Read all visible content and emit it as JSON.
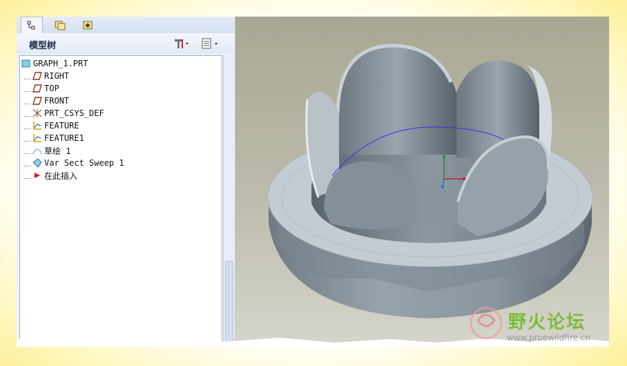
{
  "panel": {
    "header_title": "模型树",
    "tabs": [
      "model-tree-tab",
      "folder-browser-tab",
      "favorites-tab"
    ]
  },
  "tree": {
    "items": [
      {
        "label": "GRAPH_1.PRT",
        "icon": "part-icon"
      },
      {
        "label": "RIGHT",
        "icon": "datum-plane-icon"
      },
      {
        "label": "TOP",
        "icon": "datum-plane-icon"
      },
      {
        "label": "FRONT",
        "icon": "datum-plane-icon"
      },
      {
        "label": "PRT_CSYS_DEF",
        "icon": "coordinate-system-icon"
      },
      {
        "label": "FEATURE",
        "icon": "datum-graph-icon"
      },
      {
        "label": "FEATURE1",
        "icon": "datum-graph-icon"
      },
      {
        "label": "草绘 1",
        "icon": "sketch-icon"
      },
      {
        "label": "Var Sect Sweep 1",
        "icon": "sweep-icon"
      },
      {
        "label": "在此插入",
        "icon": "insert-here-arrow-icon"
      }
    ]
  },
  "watermark": {
    "brand": "野火论坛",
    "url": "www.proewildfire.cn"
  },
  "colors": {
    "panel_bg": "#eef3fb",
    "viewport_bg": "#b4b3a0",
    "model_gray": "#8f9aa3",
    "curve_blue": "#2d2df0",
    "watermark_green": "#7bbd3a"
  }
}
